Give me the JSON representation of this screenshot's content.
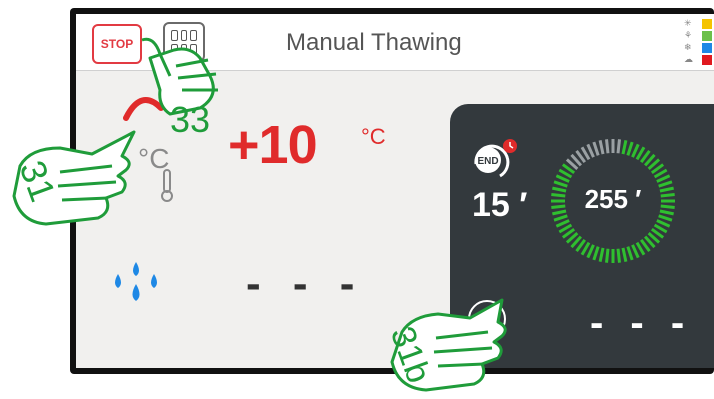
{
  "header": {
    "stop_label": "STOP",
    "title": "Manual Thawing"
  },
  "status_legend": [
    {
      "icon": "snowflake-heat-icon",
      "color": "#f5c400"
    },
    {
      "icon": "sprout-icon",
      "color": "#6cc04a"
    },
    {
      "icon": "snowflake-icon",
      "color": "#1e88e5"
    },
    {
      "icon": "cloud-icon",
      "color": "#e0191f"
    }
  ],
  "temperature": {
    "value": "+10",
    "unit": "°C",
    "icon_unit": "°C",
    "color": "#e02b2b"
  },
  "humidity": {
    "value": "- - -"
  },
  "timer": {
    "time_left": "15 ′",
    "ring_value": "255 ′",
    "end_badge": "END",
    "ring_color": "#2fbf2f"
  },
  "fan": {
    "value": "- - -"
  },
  "callouts": {
    "stop_callout": "33",
    "temp_callout": "31",
    "fan_callout": "31b",
    "color": "#1f9c3a"
  }
}
